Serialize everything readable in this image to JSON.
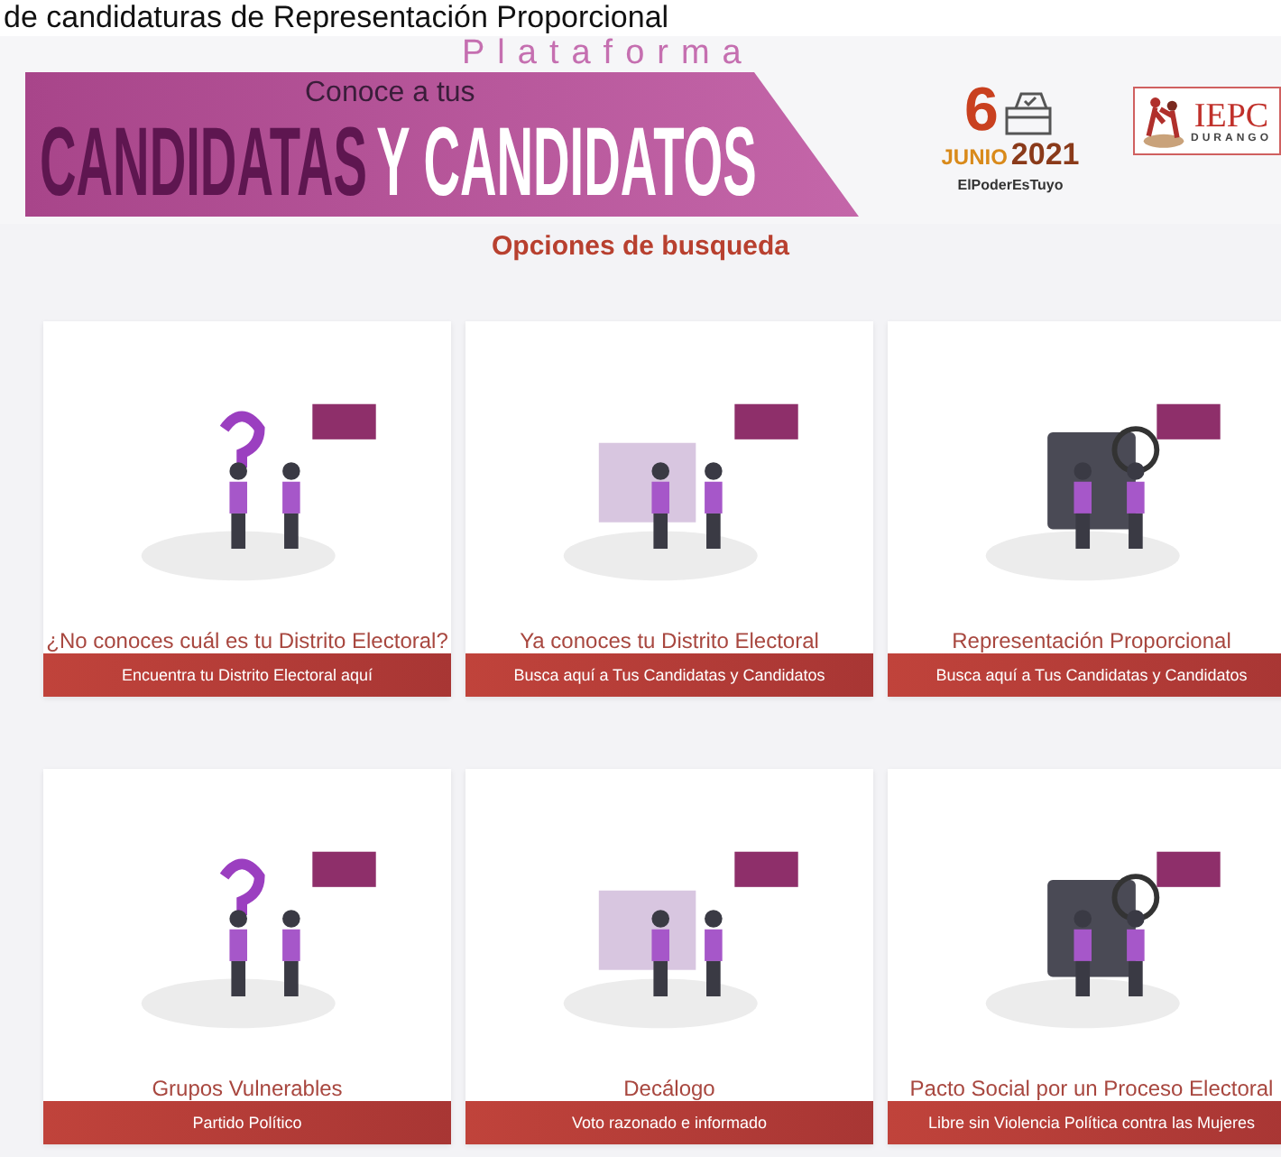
{
  "caption": "de candidaturas de Representación Proporcional",
  "header": {
    "platform_label": "Plataforma",
    "banner_intro": "Conoce a tus",
    "headline_dark": "CANDIDATAS",
    "headline_light": "Y CANDIDATOS",
    "election_logo": {
      "day": "6",
      "month": "JUNIO",
      "year": "2021",
      "hashtag": "ElPoderEsTuyo"
    },
    "institute_logo": {
      "acronym": "IEPC",
      "state": "DURANGO"
    }
  },
  "section_title": "Opciones de busqueda",
  "cards": [
    {
      "title": "¿No conoces cuál es tu Distrito Electoral?",
      "action": "Encuentra tu Distrito Electoral aquí"
    },
    {
      "title": "Ya conoces tu Distrito Electoral",
      "action": "Busca aquí a Tus Candidatas y Candidatos"
    },
    {
      "title": "Representación Proporcional",
      "action": "Busca aquí a Tus Candidatas y Candidatos"
    },
    {
      "title": "Grupos Vulnerables",
      "action": "Partido Político"
    },
    {
      "title": "Decálogo",
      "action": "Voto razonado e informado"
    },
    {
      "title": "Pacto Social por un Proceso Electoral",
      "action": "Libre sin Violencia Política contra las Mujeres"
    }
  ]
}
